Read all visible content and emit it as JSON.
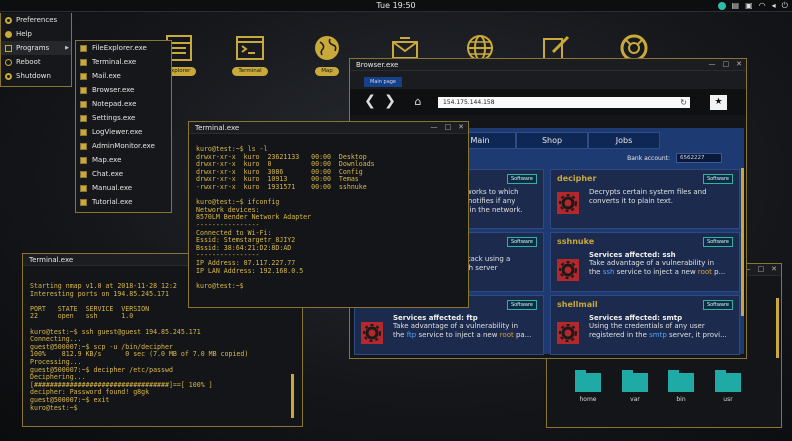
{
  "topbar": {
    "clock": "Tue 19:50"
  },
  "desktop_icons": [
    {
      "label": "Explorer",
      "icon": "file-explorer-icon"
    },
    {
      "label": "Terminal",
      "icon": "terminal-icon"
    },
    {
      "label": "Map",
      "icon": "globe-icon"
    },
    {
      "label": "",
      "icon": "mail-icon"
    },
    {
      "label": "",
      "icon": "browser-globe-icon"
    },
    {
      "label": "",
      "icon": "pencil-icon"
    },
    {
      "label": "",
      "icon": "lifebuoy-icon"
    }
  ],
  "start_menu": {
    "items": [
      {
        "label": "Preferences",
        "icon": "gear-icon"
      },
      {
        "label": "Help",
        "icon": "help-icon"
      },
      {
        "label": "Programs",
        "icon": "folder-icon",
        "arrow": "▶"
      },
      {
        "label": "Reboot",
        "icon": "reboot-icon"
      },
      {
        "label": "Shutdown",
        "icon": "power-icon"
      }
    ],
    "programs": [
      "FileExplorer.exe",
      "Terminal.exe",
      "Mail.exe",
      "Browser.exe",
      "Notepad.exe",
      "Settings.exe",
      "LogViewer.exe",
      "AdminMonitor.exe",
      "Map.exe",
      "Chat.exe",
      "Manual.exe",
      "Tutorial.exe"
    ]
  },
  "window_controls": {
    "minimize": "—",
    "maximize": "□",
    "close": "✕"
  },
  "browser": {
    "title": "Browser.exe",
    "tab": "Main page",
    "url": "154.175.144.158",
    "back": "❮",
    "forward": "❯",
    "home": "⌂",
    "star": "★",
    "reload": "↻",
    "site_tabs": [
      "Main",
      "Shop",
      "Jobs"
    ],
    "bank_label": "Bank account:",
    "bank_value": "6562227",
    "cards": [
      {
        "title": "",
        "badge": "Software",
        "desc_pre": "etworks to which",
        "desc_2": "d, notifies if any",
        "desc_3": "ve in the network."
      },
      {
        "title": "decipher",
        "badge": "Software",
        "desc": "Decrypts certain system files and converts it to plain text."
      },
      {
        "title": "",
        "badge": "Software",
        "desc_1": "ttack using a",
        "desc_2": "sh server"
      },
      {
        "title": "sshnuke",
        "badge": "Software",
        "affected": "Services affected: ssh",
        "d1": "Take advantage of a vulnerability in",
        "d2a": "the ",
        "d2b": "ssh",
        "d2c": " service to inject a new ",
        "d2d": "root",
        "d2e": " p..."
      },
      {
        "title": "",
        "badge": "Software",
        "affected": "Services affected: ftp",
        "d1": "Take advantage of a vulnerability in",
        "d2a": "the ",
        "d2b": "ftp",
        "d2c": " service to inject a new ",
        "d2d": "root",
        "d2e": " pa..."
      },
      {
        "title": "shellmail",
        "badge": "Software",
        "affected": "Services affected: smtp",
        "d1": "Using the credentials of any user",
        "d2a": "registered in the ",
        "d2b": "smtp",
        "d2c": " server, it provi...",
        "d2d": "",
        "d2e": ""
      }
    ]
  },
  "terminal1": {
    "title": "Terminal.exe",
    "lines": "kuro@test:~$ ls -l\ndrwxr-xr-x  kuro  23621133   00:00  Desktop\ndrwxr-xr-x  kuro  0          00:00  Downloads\ndrwxr-xr-x  kuro  3086       00:00  Config\ndrwxr-xr-x  kuro  10913      00:00  Temas\n-rwxr-xr-x  kuro  1931571    00:00  sshnuke\n\nkuro@test:~$ ifconfig\nNetwork devices:\n8570LM Bender Network Adapter\n----------------\nConnected to Wi-Fi:\nEssid: Stemstargetr_8JIY2\nBssid: 38:64:21:D2:8D:AD\n----------------\nIP Address: 87.117.227.77\nIP LAN Address: 192.168.0.5\n\nkuro@test:~$"
  },
  "terminal2": {
    "title": "Terminal.exe",
    "lines": "Starting nmap v1.0 at 2018-11-28 12:2\nInteresting ports on 194.85.245.171\n\nPORT   STATE  SERVICE  VERSION\n22     open   ssh      1.0\n\nkuro@test:~$ ssh guest@guest 194.85.245.171\nConnecting...\nguest@500007:~$ scp -u /bin/decipher\n100%    812.9 KB/s      0 sec (7.0 MB of 7.0 MB copied)\nProcessing...\nguest@500007:~$ decipher /etc/passwd\nDeciphering...\n[##################################]==[ 100% ]\ndecipher: Password found! g8gk\nguest@500007:~$ exit\nkuro@test:~$"
  },
  "file_manager": {
    "folders": [
      "home",
      "var",
      "bin",
      "usr"
    ]
  },
  "colors": {
    "accent": "#c9a93a",
    "folder": "#1faaa6",
    "site_bg": "#1e3a72",
    "danger": "#b3282d"
  }
}
